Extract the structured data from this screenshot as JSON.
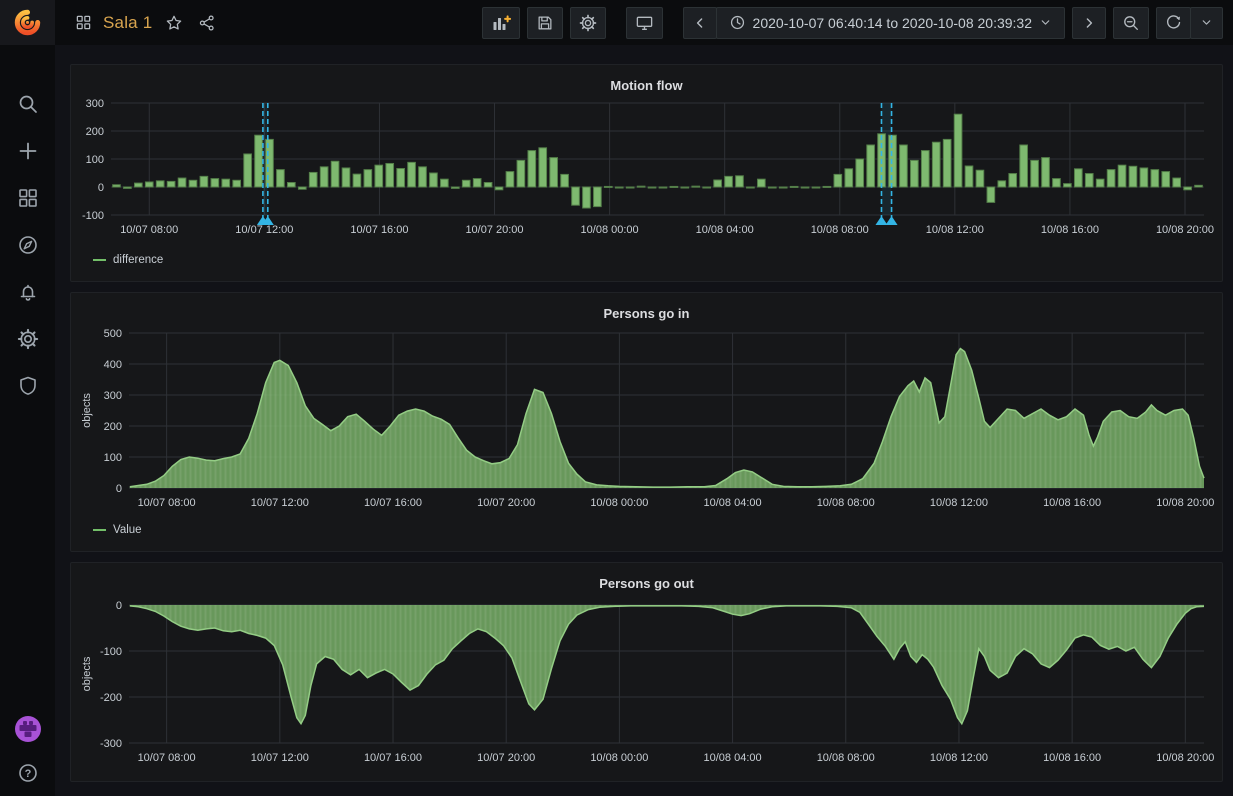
{
  "navbar": {
    "title": "Sala 1",
    "time_range": "2020-10-07 06:40:14 to 2020-10-08 20:39:32"
  },
  "sidebar": {
    "icons": [
      "grafana-logo",
      "search",
      "create-plus",
      "dashboards",
      "explore-compass",
      "alerting-bell",
      "configuration-gear",
      "server-admin-shield",
      "user-avatar",
      "help"
    ]
  },
  "toolbar": {
    "icons": [
      "add-panel",
      "save-dashboard",
      "dashboard-settings",
      "cycle-view-mode",
      "time-range-back",
      "time-picker",
      "time-range-forward",
      "zoom-out-time",
      "refresh",
      "refresh-interval-caret"
    ]
  },
  "colors": {
    "green": "#73bf69",
    "bar_fill": "#7eb96f",
    "bar_stroke": "#55804a",
    "area_fill": "#7ab46a",
    "area_line": "#94cd85",
    "annotation": "#33b5e5",
    "grid": "#2e3136",
    "tick_text": "#c8ced4",
    "title_accent": "#d9a54f"
  },
  "chart_data": [
    {
      "type": "bar",
      "title": "Motion flow",
      "legend": "difference",
      "ylabel": "",
      "yticks": [
        -100,
        0,
        100,
        200,
        300
      ],
      "ylim": [
        -100,
        300
      ],
      "x_range_hours": [
        6.67,
        44.66
      ],
      "xticks": {
        "hours": [
          8,
          12,
          16,
          20,
          24,
          28,
          32,
          36,
          40,
          44
        ],
        "labels": [
          "10/07 08:00",
          "10/07 12:00",
          "10/07 16:00",
          "10/07 20:00",
          "10/08 00:00",
          "10/08 04:00",
          "10/08 08:00",
          "10/08 12:00",
          "10/08 16:00",
          "10/08 20:00"
        ]
      },
      "annotation_regions_hours": [
        [
          11.95,
          12.12
        ],
        [
          33.45,
          33.8
        ]
      ],
      "values": [
        8,
        -5,
        14,
        18,
        22,
        20,
        32,
        24,
        38,
        30,
        28,
        24,
        118,
        185,
        170,
        62,
        16,
        -8,
        52,
        72,
        92,
        68,
        46,
        62,
        78,
        84,
        66,
        88,
        72,
        50,
        28,
        -5,
        24,
        30,
        16,
        -10,
        55,
        95,
        130,
        140,
        105,
        45,
        -65,
        -75,
        -70,
        2,
        -3,
        0,
        3,
        0,
        -2,
        2,
        0,
        3,
        -2,
        25,
        38,
        40,
        0,
        28,
        0,
        -2,
        2,
        0,
        -3,
        2,
        45,
        65,
        100,
        150,
        190,
        185,
        150,
        95,
        130,
        160,
        170,
        260,
        75,
        60,
        -55,
        22,
        48,
        150,
        95,
        105,
        30,
        12,
        65,
        48,
        28,
        62,
        78,
        74,
        68,
        62,
        55,
        32,
        -10,
        6
      ]
    },
    {
      "type": "area",
      "title": "Persons go in",
      "legend": "Value",
      "ylabel": "objects",
      "yticks": [
        0,
        100,
        200,
        300,
        400,
        500
      ],
      "ylim": [
        0,
        500
      ],
      "x_range_hours": [
        6.67,
        44.66
      ],
      "xticks": {
        "hours": [
          8,
          12,
          16,
          20,
          24,
          28,
          32,
          36,
          40,
          44
        ],
        "labels": [
          "10/07 08:00",
          "10/07 12:00",
          "10/07 16:00",
          "10/07 20:00",
          "10/08 00:00",
          "10/08 04:00",
          "10/08 08:00",
          "10/08 12:00",
          "10/08 16:00",
          "10/08 20:00"
        ]
      },
      "points": [
        [
          6.7,
          4
        ],
        [
          7.0,
          8
        ],
        [
          7.3,
          12
        ],
        [
          7.6,
          22
        ],
        [
          7.9,
          40
        ],
        [
          8.2,
          70
        ],
        [
          8.5,
          92
        ],
        [
          8.8,
          100
        ],
        [
          9.1,
          96
        ],
        [
          9.4,
          90
        ],
        [
          9.7,
          88
        ],
        [
          10.0,
          95
        ],
        [
          10.3,
          100
        ],
        [
          10.6,
          110
        ],
        [
          10.9,
          160
        ],
        [
          11.2,
          240
        ],
        [
          11.5,
          340
        ],
        [
          11.8,
          405
        ],
        [
          12.0,
          412
        ],
        [
          12.3,
          395
        ],
        [
          12.6,
          340
        ],
        [
          12.9,
          265
        ],
        [
          13.2,
          225
        ],
        [
          13.5,
          205
        ],
        [
          13.8,
          185
        ],
        [
          14.1,
          200
        ],
        [
          14.4,
          230
        ],
        [
          14.7,
          238
        ],
        [
          15.0,
          215
        ],
        [
          15.3,
          190
        ],
        [
          15.6,
          170
        ],
        [
          15.9,
          200
        ],
        [
          16.2,
          235
        ],
        [
          16.5,
          248
        ],
        [
          16.8,
          255
        ],
        [
          17.1,
          248
        ],
        [
          17.4,
          232
        ],
        [
          17.7,
          222
        ],
        [
          18.0,
          205
        ],
        [
          18.3,
          162
        ],
        [
          18.6,
          122
        ],
        [
          18.9,
          100
        ],
        [
          19.2,
          88
        ],
        [
          19.5,
          78
        ],
        [
          19.8,
          82
        ],
        [
          20.1,
          95
        ],
        [
          20.4,
          140
        ],
        [
          20.7,
          240
        ],
        [
          21.0,
          318
        ],
        [
          21.3,
          308
        ],
        [
          21.6,
          240
        ],
        [
          21.9,
          150
        ],
        [
          22.2,
          80
        ],
        [
          22.5,
          45
        ],
        [
          22.8,
          20
        ],
        [
          23.2,
          10
        ],
        [
          23.6,
          7
        ],
        [
          24.0,
          5
        ],
        [
          24.6,
          4
        ],
        [
          25.2,
          3
        ],
        [
          25.8,
          3
        ],
        [
          26.4,
          4
        ],
        [
          27.0,
          4
        ],
        [
          27.4,
          8
        ],
        [
          27.8,
          30
        ],
        [
          28.1,
          50
        ],
        [
          28.4,
          58
        ],
        [
          28.7,
          52
        ],
        [
          29.0,
          35
        ],
        [
          29.4,
          12
        ],
        [
          29.8,
          5
        ],
        [
          30.3,
          4
        ],
        [
          30.8,
          4
        ],
        [
          31.3,
          5
        ],
        [
          31.8,
          7
        ],
        [
          32.2,
          12
        ],
        [
          32.6,
          30
        ],
        [
          33.0,
          80
        ],
        [
          33.3,
          150
        ],
        [
          33.6,
          230
        ],
        [
          33.9,
          295
        ],
        [
          34.2,
          330
        ],
        [
          34.4,
          345
        ],
        [
          34.6,
          310
        ],
        [
          34.8,
          355
        ],
        [
          35.0,
          340
        ],
        [
          35.3,
          210
        ],
        [
          35.5,
          230
        ],
        [
          35.7,
          330
        ],
        [
          35.9,
          430
        ],
        [
          36.05,
          450
        ],
        [
          36.2,
          440
        ],
        [
          36.45,
          380
        ],
        [
          36.7,
          290
        ],
        [
          36.9,
          215
        ],
        [
          37.1,
          195
        ],
        [
          37.4,
          225
        ],
        [
          37.7,
          255
        ],
        [
          38.0,
          250
        ],
        [
          38.3,
          225
        ],
        [
          38.6,
          240
        ],
        [
          38.9,
          255
        ],
        [
          39.2,
          235
        ],
        [
          39.5,
          220
        ],
        [
          39.8,
          230
        ],
        [
          40.1,
          255
        ],
        [
          40.4,
          235
        ],
        [
          40.6,
          170
        ],
        [
          40.75,
          135
        ],
        [
          40.9,
          165
        ],
        [
          41.1,
          215
        ],
        [
          41.4,
          245
        ],
        [
          41.7,
          250
        ],
        [
          42.0,
          230
        ],
        [
          42.3,
          225
        ],
        [
          42.6,
          245
        ],
        [
          42.8,
          268
        ],
        [
          43.0,
          250
        ],
        [
          43.3,
          235
        ],
        [
          43.6,
          250
        ],
        [
          43.9,
          255
        ],
        [
          44.1,
          235
        ],
        [
          44.3,
          160
        ],
        [
          44.5,
          70
        ],
        [
          44.66,
          32
        ]
      ]
    },
    {
      "type": "area",
      "title": "Persons go out",
      "legend": "",
      "ylabel": "objects",
      "yticks": [
        -300,
        -200,
        -100,
        0
      ],
      "ylim": [
        -300,
        0
      ],
      "x_range_hours": [
        6.67,
        44.66
      ],
      "xticks": {
        "hours": [
          8,
          12,
          16,
          20,
          24,
          28,
          32,
          36,
          40,
          44
        ],
        "labels": [
          "10/07 08:00",
          "10/07 12:00",
          "10/07 16:00",
          "10/07 20:00",
          "10/08 00:00",
          "10/08 04:00",
          "10/08 08:00",
          "10/08 12:00",
          "10/08 16:00",
          "10/08 20:00"
        ]
      },
      "points": [
        [
          6.7,
          -2
        ],
        [
          7.0,
          -4
        ],
        [
          7.3,
          -8
        ],
        [
          7.6,
          -14
        ],
        [
          7.9,
          -24
        ],
        [
          8.2,
          -36
        ],
        [
          8.5,
          -46
        ],
        [
          8.8,
          -52
        ],
        [
          9.1,
          -55
        ],
        [
          9.4,
          -52
        ],
        [
          9.7,
          -50
        ],
        [
          10.0,
          -56
        ],
        [
          10.3,
          -58
        ],
        [
          10.6,
          -55
        ],
        [
          10.9,
          -62
        ],
        [
          11.2,
          -66
        ],
        [
          11.5,
          -72
        ],
        [
          11.8,
          -88
        ],
        [
          12.1,
          -130
        ],
        [
          12.4,
          -200
        ],
        [
          12.6,
          -245
        ],
        [
          12.75,
          -258
        ],
        [
          12.9,
          -240
        ],
        [
          13.1,
          -175
        ],
        [
          13.3,
          -128
        ],
        [
          13.6,
          -112
        ],
        [
          13.9,
          -118
        ],
        [
          14.2,
          -140
        ],
        [
          14.5,
          -152
        ],
        [
          14.8,
          -140
        ],
        [
          15.1,
          -158
        ],
        [
          15.4,
          -148
        ],
        [
          15.7,
          -140
        ],
        [
          16.0,
          -150
        ],
        [
          16.3,
          -168
        ],
        [
          16.6,
          -185
        ],
        [
          16.9,
          -175
        ],
        [
          17.2,
          -150
        ],
        [
          17.5,
          -130
        ],
        [
          17.8,
          -120
        ],
        [
          18.1,
          -95
        ],
        [
          18.4,
          -78
        ],
        [
          18.7,
          -62
        ],
        [
          19.0,
          -52
        ],
        [
          19.3,
          -58
        ],
        [
          19.6,
          -72
        ],
        [
          19.9,
          -88
        ],
        [
          20.2,
          -115
        ],
        [
          20.5,
          -165
        ],
        [
          20.8,
          -215
        ],
        [
          21.0,
          -228
        ],
        [
          21.3,
          -205
        ],
        [
          21.6,
          -138
        ],
        [
          21.9,
          -78
        ],
        [
          22.2,
          -42
        ],
        [
          22.5,
          -22
        ],
        [
          22.9,
          -10
        ],
        [
          23.3,
          -5
        ],
        [
          23.8,
          -3
        ],
        [
          24.4,
          -2
        ],
        [
          25.0,
          -2
        ],
        [
          25.6,
          -2
        ],
        [
          26.2,
          -2
        ],
        [
          26.8,
          -3
        ],
        [
          27.3,
          -6
        ],
        [
          27.7,
          -14
        ],
        [
          28.0,
          -20
        ],
        [
          28.3,
          -23
        ],
        [
          28.6,
          -19
        ],
        [
          29.0,
          -9
        ],
        [
          29.4,
          -4
        ],
        [
          29.9,
          -2
        ],
        [
          30.5,
          -2
        ],
        [
          31.1,
          -2
        ],
        [
          31.7,
          -3
        ],
        [
          32.2,
          -6
        ],
        [
          32.5,
          -16
        ],
        [
          32.8,
          -42
        ],
        [
          33.1,
          -68
        ],
        [
          33.4,
          -90
        ],
        [
          33.7,
          -118
        ],
        [
          33.9,
          -95
        ],
        [
          34.1,
          -80
        ],
        [
          34.3,
          -112
        ],
        [
          34.5,
          -125
        ],
        [
          34.7,
          -108
        ],
        [
          34.9,
          -118
        ],
        [
          35.1,
          -135
        ],
        [
          35.4,
          -175
        ],
        [
          35.7,
          -205
        ],
        [
          35.95,
          -245
        ],
        [
          36.1,
          -258
        ],
        [
          36.3,
          -230
        ],
        [
          36.5,
          -160
        ],
        [
          36.7,
          -95
        ],
        [
          36.9,
          -112
        ],
        [
          37.1,
          -142
        ],
        [
          37.4,
          -158
        ],
        [
          37.7,
          -148
        ],
        [
          38.0,
          -112
        ],
        [
          38.3,
          -95
        ],
        [
          38.6,
          -106
        ],
        [
          38.9,
          -128
        ],
        [
          39.2,
          -136
        ],
        [
          39.5,
          -120
        ],
        [
          39.8,
          -98
        ],
        [
          40.1,
          -72
        ],
        [
          40.4,
          -65
        ],
        [
          40.7,
          -70
        ],
        [
          41.0,
          -88
        ],
        [
          41.3,
          -96
        ],
        [
          41.6,
          -90
        ],
        [
          41.9,
          -100
        ],
        [
          42.2,
          -92
        ],
        [
          42.5,
          -118
        ],
        [
          42.8,
          -136
        ],
        [
          43.1,
          -112
        ],
        [
          43.4,
          -72
        ],
        [
          43.7,
          -42
        ],
        [
          44.0,
          -18
        ],
        [
          44.2,
          -8
        ],
        [
          44.4,
          -4
        ],
        [
          44.66,
          -3
        ]
      ]
    }
  ]
}
